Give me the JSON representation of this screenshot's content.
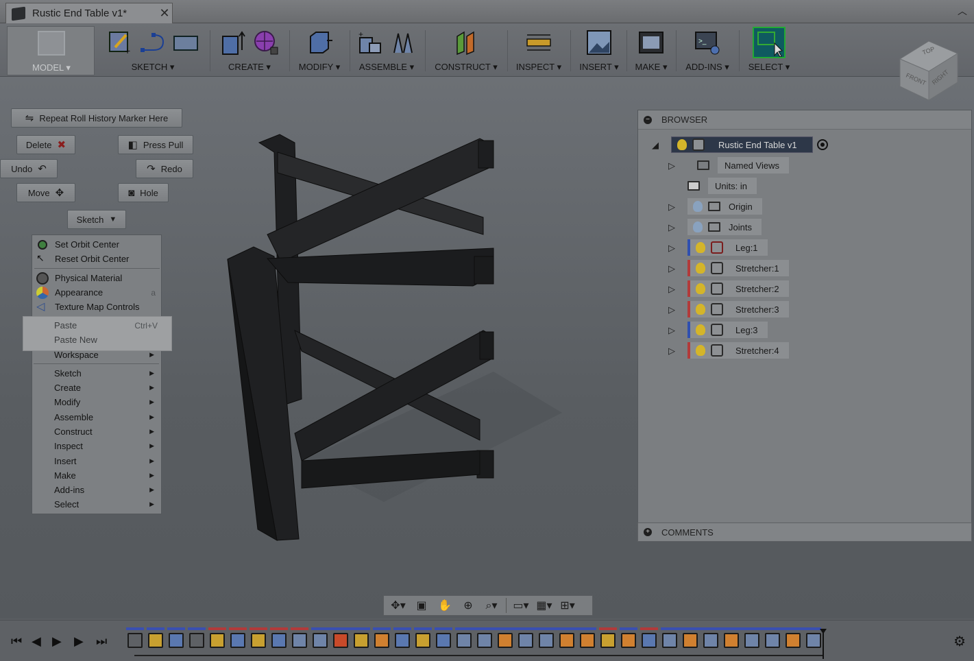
{
  "window": {
    "tab_title": "Rustic End Table v1*",
    "close_glyph": "✕",
    "collapse_glyph": "︿"
  },
  "toolbar": {
    "groups": [
      {
        "label": "MODEL ▾"
      },
      {
        "label": "SKETCH ▾"
      },
      {
        "label": "CREATE ▾"
      },
      {
        "label": "MODIFY ▾"
      },
      {
        "label": "ASSEMBLE ▾"
      },
      {
        "label": "CONSTRUCT ▾"
      },
      {
        "label": "INSPECT ▾"
      },
      {
        "label": "INSERT ▾"
      },
      {
        "label": "MAKE ▾"
      },
      {
        "label": "ADD-INS ▾"
      },
      {
        "label": "SELECT ▾"
      }
    ]
  },
  "viewcube": {
    "top": "TOP",
    "front": "FRONT",
    "right": "RIGHT"
  },
  "marking_menu": {
    "repeat": "Repeat Roll History Marker Here",
    "delete": "Delete",
    "press_pull": "Press Pull",
    "undo": "Undo",
    "redo": "Redo",
    "move": "Move",
    "hole": "Hole",
    "sketch": "Sketch"
  },
  "context_menu": {
    "items": [
      {
        "label": "Set Orbit Center"
      },
      {
        "label": "Reset Orbit Center"
      },
      {
        "label": "Physical Material"
      },
      {
        "label": "Appearance",
        "key": "a"
      },
      {
        "label": "Texture Map Controls"
      },
      {
        "label": "Paste",
        "key": "Ctrl+V"
      },
      {
        "label": "Paste New"
      },
      {
        "label": "Workspace"
      },
      {
        "label": "Sketch"
      },
      {
        "label": "Create"
      },
      {
        "label": "Modify"
      },
      {
        "label": "Assemble"
      },
      {
        "label": "Construct"
      },
      {
        "label": "Inspect"
      },
      {
        "label": "Insert"
      },
      {
        "label": "Make"
      },
      {
        "label": "Add-ins"
      },
      {
        "label": "Select"
      }
    ]
  },
  "browser": {
    "header": "BROWSER",
    "root": "Rustic End Table v1",
    "nodes": [
      {
        "label": "Named Views"
      },
      {
        "label": "Units: in"
      },
      {
        "label": "Origin"
      },
      {
        "label": "Joints"
      },
      {
        "label": "Leg:1",
        "color": "#2f4fb0"
      },
      {
        "label": "Stretcher:1",
        "color": "#b23a3a"
      },
      {
        "label": "Stretcher:2",
        "color": "#b23a3a"
      },
      {
        "label": "Stretcher:3",
        "color": "#b23a3a"
      },
      {
        "label": "Leg:3",
        "color": "#2f4fb0"
      },
      {
        "label": "Stretcher:4",
        "color": "#b23a3a"
      }
    ]
  },
  "comments": {
    "header": "COMMENTS"
  },
  "colors": {
    "accent_blue": "#2f4fb0",
    "accent_red": "#b23a3a",
    "bulb_on": "#d4b52a",
    "select_active": "#0f5a60"
  }
}
